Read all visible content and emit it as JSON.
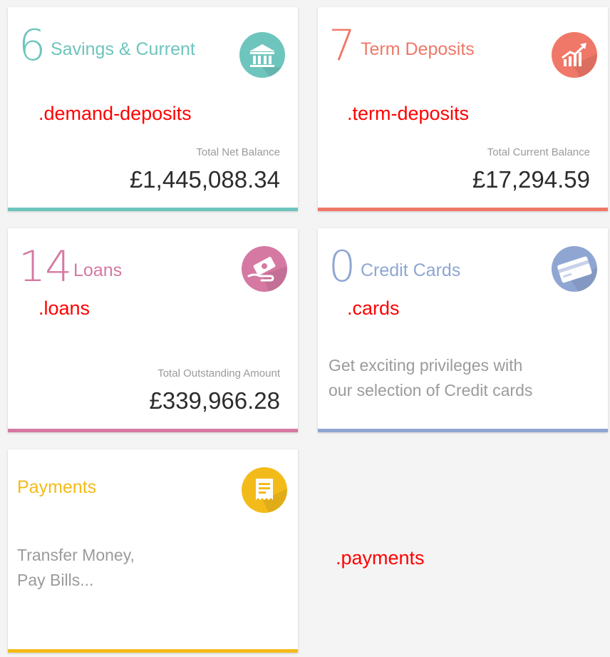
{
  "colors": {
    "demand": "#6ec5bd",
    "term": "#ef7868",
    "loans": "#d579a2",
    "cards": "#8fa6d3",
    "payments": "#f3bb1a",
    "annotation": "#ff0000"
  },
  "cards": {
    "demand_deposits": {
      "count": "6",
      "title": "Savings & Current",
      "balance_label": "Total Net Balance",
      "balance_value": "£1,445,088.34",
      "icon": "bank-icon",
      "css_label": ".demand-deposits"
    },
    "term_deposits": {
      "count": "7",
      "title": "Term Deposits",
      "balance_label": "Total Current Balance",
      "balance_value": "£17,294.59",
      "icon": "growth-chart-icon",
      "css_label": ".term-deposits"
    },
    "loans": {
      "count": "14",
      "title": "Loans",
      "balance_label": "Total Outstanding Amount",
      "balance_value": "£339,966.28",
      "icon": "hand-money-icon",
      "css_label": ".loans"
    },
    "cards": {
      "count": "0",
      "title": "Credit Cards",
      "description_line1": "Get exciting privileges with",
      "description_line2": "our selection of Credit cards",
      "icon": "credit-card-icon",
      "css_label": ".cards"
    },
    "payments": {
      "title": "Payments",
      "description_line1": "Transfer Money,",
      "description_line2": "Pay Bills...",
      "icon": "receipt-icon",
      "css_label": ".payments"
    }
  }
}
